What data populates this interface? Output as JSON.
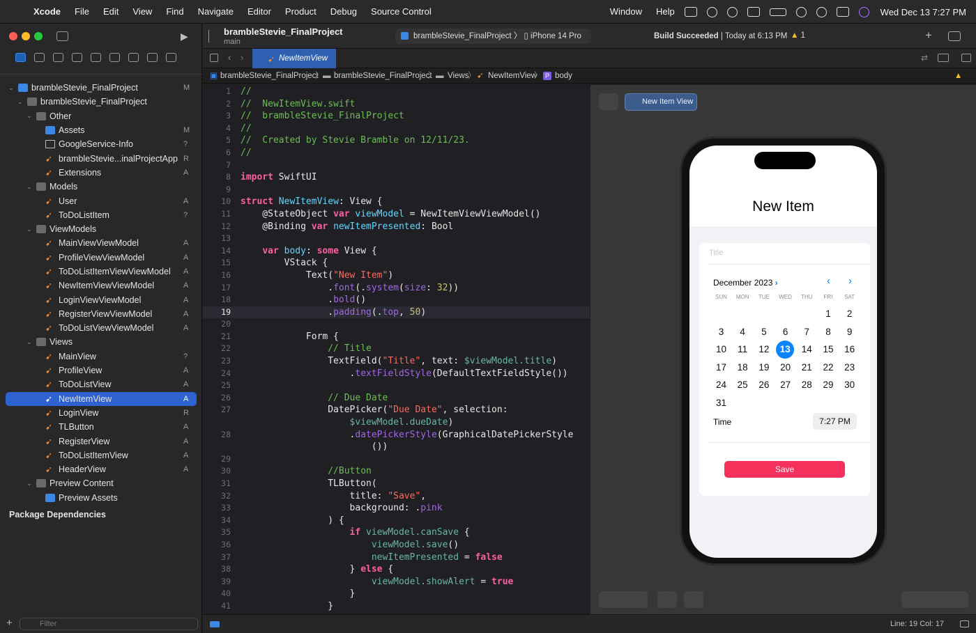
{
  "menubar": {
    "app": "Xcode",
    "items": [
      "File",
      "Edit",
      "View",
      "Find",
      "Navigate",
      "Editor",
      "Product",
      "Debug",
      "Source Control",
      "Window",
      "Help"
    ],
    "clock": "Wed Dec 13  7:27 PM"
  },
  "toolbar": {
    "project": "brambleStevie_FinalProject",
    "branch": "main",
    "scheme": "brambleStevie_FinalProject",
    "device": "iPhone 14 Pro",
    "build_status": "Build Succeeded",
    "build_time": "Today at 6:13 PM",
    "warnings": "1"
  },
  "tab": {
    "label": "NewItemView"
  },
  "jumpbar": [
    "brambleStevie_FinalProject",
    "brambleStevie_FinalProject",
    "Views",
    "NewItemView",
    "body"
  ],
  "navigator": {
    "items": [
      {
        "label": "brambleStevie_FinalProject",
        "badge": "M",
        "level": 0,
        "type": "project"
      },
      {
        "label": "brambleStevie_FinalProject",
        "badge": "",
        "level": 1,
        "type": "folder"
      },
      {
        "label": "Other",
        "badge": "",
        "level": 2,
        "type": "folder"
      },
      {
        "label": "Assets",
        "badge": "M",
        "level": 3,
        "type": "assets"
      },
      {
        "label": "GoogleService-Info",
        "badge": "?",
        "level": 3,
        "type": "plist"
      },
      {
        "label": "brambleStevie...inalProjectApp",
        "badge": "R",
        "level": 3,
        "type": "swift"
      },
      {
        "label": "Extensions",
        "badge": "A",
        "level": 3,
        "type": "swift"
      },
      {
        "label": "Models",
        "badge": "",
        "level": 2,
        "type": "folder"
      },
      {
        "label": "User",
        "badge": "A",
        "level": 3,
        "type": "swift"
      },
      {
        "label": "ToDoListItem",
        "badge": "?",
        "level": 3,
        "type": "swift"
      },
      {
        "label": "ViewModels",
        "badge": "",
        "level": 2,
        "type": "folder"
      },
      {
        "label": "MainViewViewModel",
        "badge": "A",
        "level": 3,
        "type": "swift"
      },
      {
        "label": "ProfileViewViewModel",
        "badge": "A",
        "level": 3,
        "type": "swift"
      },
      {
        "label": "ToDoListItemViewViewModel",
        "badge": "A",
        "level": 3,
        "type": "swift"
      },
      {
        "label": "NewItemViewViewModel",
        "badge": "A",
        "level": 3,
        "type": "swift"
      },
      {
        "label": "LoginViewViewModel",
        "badge": "A",
        "level": 3,
        "type": "swift"
      },
      {
        "label": "RegisterViewViewModel",
        "badge": "A",
        "level": 3,
        "type": "swift"
      },
      {
        "label": "ToDoListViewViewModel",
        "badge": "A",
        "level": 3,
        "type": "swift"
      },
      {
        "label": "Views",
        "badge": "",
        "level": 2,
        "type": "folder"
      },
      {
        "label": "MainView",
        "badge": "?",
        "level": 3,
        "type": "swift"
      },
      {
        "label": "ProfileView",
        "badge": "A",
        "level": 3,
        "type": "swift"
      },
      {
        "label": "ToDoListView",
        "badge": "A",
        "level": 3,
        "type": "swift"
      },
      {
        "label": "NewItemView",
        "badge": "A",
        "level": 3,
        "type": "swift",
        "selected": true
      },
      {
        "label": "LoginView",
        "badge": "R",
        "level": 3,
        "type": "swift"
      },
      {
        "label": "TLButton",
        "badge": "A",
        "level": 3,
        "type": "swift"
      },
      {
        "label": "RegisterView",
        "badge": "A",
        "level": 3,
        "type": "swift"
      },
      {
        "label": "ToDoListItemView",
        "badge": "A",
        "level": 3,
        "type": "swift"
      },
      {
        "label": "HeaderView",
        "badge": "A",
        "level": 3,
        "type": "swift"
      },
      {
        "label": "Preview Content",
        "badge": "",
        "level": 2,
        "type": "folder"
      },
      {
        "label": "Preview Assets",
        "badge": "",
        "level": 3,
        "type": "assets"
      }
    ],
    "package_dependencies": "Package Dependencies",
    "filter_placeholder": "Filter"
  },
  "code_lines": [
    {
      "n": "1",
      "h": "<span class=cm>//</span>"
    },
    {
      "n": "2",
      "h": "<span class=cm>//  NewItemView.swift</span>"
    },
    {
      "n": "3",
      "h": "<span class=cm>//  brambleStevie_FinalProject</span>"
    },
    {
      "n": "4",
      "h": "<span class=cm>//</span>"
    },
    {
      "n": "5",
      "h": "<span class=cm>//  Created by Stevie Bramble on 12/11/23.</span>"
    },
    {
      "n": "6",
      "h": "<span class=cm>//</span>"
    },
    {
      "n": "7",
      "h": ""
    },
    {
      "n": "8",
      "h": "<span class=kw>import</span> SwiftUI"
    },
    {
      "n": "9",
      "h": ""
    },
    {
      "n": "10",
      "h": "<span class=kw>struct</span> <span class=ty>NewItemView</span>: View {"
    },
    {
      "n": "11",
      "h": "    @StateObject <span class=kw>var</span> <span class=ty>viewModel</span> = NewItemViewViewModel()"
    },
    {
      "n": "12",
      "h": "    @Binding <span class=kw>var</span> <span class=ty>newItemPresented</span>: Bool"
    },
    {
      "n": "13",
      "h": ""
    },
    {
      "n": "14",
      "h": "    <span class=kw>var</span> <span class=ty>body</span>: <span class=kw>some</span> View {"
    },
    {
      "n": "15",
      "h": "        VStack {"
    },
    {
      "n": "16",
      "h": "            Text(<span class=st>\"New Item\"</span>)"
    },
    {
      "n": "17",
      "h": "                .<span class=fn>font</span>(.<span class=fn>system</span>(<span class=fn>size</span>: <span class=nu>32</span>))"
    },
    {
      "n": "18",
      "h": "                .<span class=fn>bold</span>()"
    },
    {
      "n": "19",
      "h": "                .<span class=fn>padding</span>(.<span class=fn>top</span>, <span class=nu>50</span>)",
      "hl": true
    },
    {
      "n": "20",
      "h": ""
    },
    {
      "n": "21",
      "h": "            Form {"
    },
    {
      "n": "22",
      "h": "                <span class=cm>// Title</span>"
    },
    {
      "n": "23",
      "h": "                TextField(<span class=st>\"Title\"</span>, text: <span class=pr>$viewModel.title</span>)"
    },
    {
      "n": "24",
      "h": "                    .<span class=fn>textFieldStyle</span>(DefaultTextFieldStyle())"
    },
    {
      "n": "25",
      "h": ""
    },
    {
      "n": "26",
      "h": "                <span class=cm>// Due Date</span>"
    },
    {
      "n": "27",
      "h": "                DatePicker(<span class=st>\"Due Date\"</span>, selection:"
    },
    {
      "n": "",
      "h": "                    <span class=pr>$viewModel.dueDate</span>)"
    },
    {
      "n": "28",
      "h": "                    .<span class=fn>datePickerStyle</span>(GraphicalDatePickerStyle"
    },
    {
      "n": "",
      "h": "                        ())"
    },
    {
      "n": "29",
      "h": ""
    },
    {
      "n": "30",
      "h": "                <span class=cm>//Button</span>"
    },
    {
      "n": "31",
      "h": "                TLButton("
    },
    {
      "n": "32",
      "h": "                    title: <span class=st>\"Save\"</span>,"
    },
    {
      "n": "33",
      "h": "                    background: .<span class=fn>pink</span>"
    },
    {
      "n": "34",
      "h": "                ) {"
    },
    {
      "n": "35",
      "h": "                    <span class=kw>if</span> <span class=pr>viewModel.canSave</span> {"
    },
    {
      "n": "36",
      "h": "                        <span class=pr>viewModel.save</span>()"
    },
    {
      "n": "37",
      "h": "                        <span class=pr>newItemPresented</span> = <span class=kw>false</span>"
    },
    {
      "n": "38",
      "h": "                    } <span class=kw>else</span> {"
    },
    {
      "n": "39",
      "h": "                        <span class=pr>viewModel.showAlert</span> = <span class=kw>true</span>"
    },
    {
      "n": "40",
      "h": "                    }"
    },
    {
      "n": "41",
      "h": "                }"
    }
  ],
  "preview": {
    "tab_label": "New Item View",
    "title": "New Item",
    "title_placeholder": "Title",
    "month": "December 2023",
    "weekdays": [
      "SUN",
      "MON",
      "TUE",
      "WED",
      "THU",
      "FRI",
      "SAT"
    ],
    "days": [
      "1",
      "2",
      "3",
      "4",
      "5",
      "6",
      "7",
      "8",
      "9",
      "10",
      "11",
      "12",
      "13",
      "14",
      "15",
      "16",
      "17",
      "18",
      "19",
      "20",
      "21",
      "22",
      "23",
      "24",
      "25",
      "26",
      "27",
      "28",
      "29",
      "30",
      "31"
    ],
    "first_weekday": 5,
    "today": "13",
    "time_label": "Time",
    "time_value": "7:27 PM",
    "save_label": "Save"
  },
  "status": {
    "line_col": "Line: 19  Col: 17"
  },
  "colors": {
    "accent": "#0a84ff",
    "save": "#f5305a",
    "selection": "#2e62d0"
  }
}
